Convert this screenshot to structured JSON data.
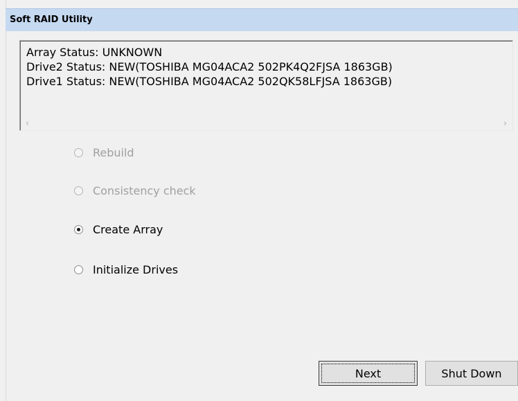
{
  "window": {
    "title": "Soft RAID Utility"
  },
  "status": {
    "lines": [
      "Array Status: UNKNOWN",
      "Drive2 Status: NEW(TOSHIBA MG04ACA2 502PK4Q2FJSA 1863GB)",
      "Drive1 Status: NEW(TOSHIBA MG04ACA2 502QK58LFJSA 1863GB)"
    ],
    "scroll_left_icon": "chevron-left-icon",
    "scroll_right_icon": "chevron-right-icon"
  },
  "options": [
    {
      "label": "Rebuild",
      "checked": false,
      "enabled": false
    },
    {
      "label": "Consistency check",
      "checked": false,
      "enabled": false
    },
    {
      "label": "Create Array",
      "checked": true,
      "enabled": true
    },
    {
      "label": "Initialize Drives",
      "checked": false,
      "enabled": true
    }
  ],
  "buttons": {
    "next_label": "Next",
    "shutdown_label": "Shut Down"
  }
}
